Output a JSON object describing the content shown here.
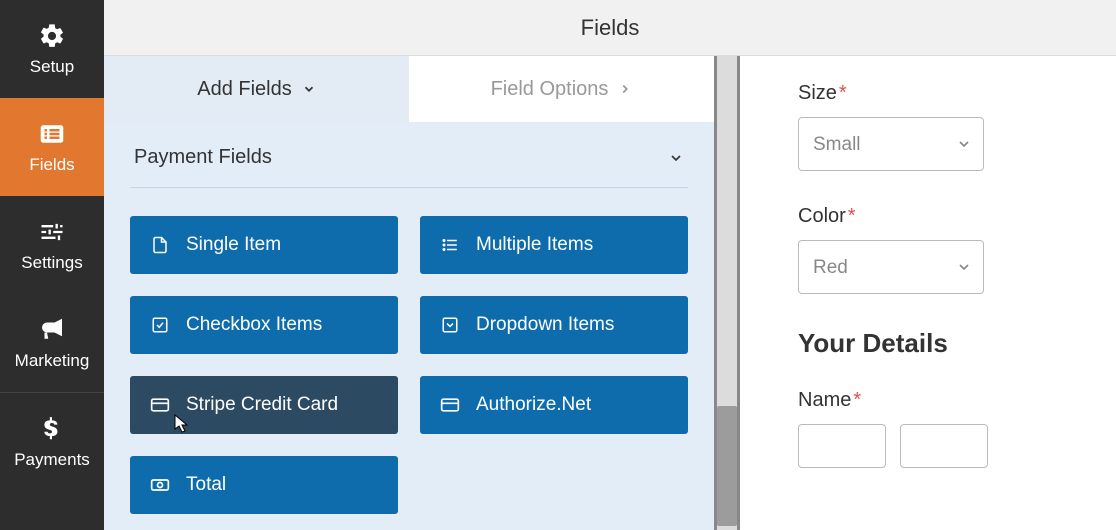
{
  "colors": {
    "accent": "#e27730",
    "primary_btn": "#0e6cad",
    "dark": "#2d2d2d"
  },
  "header": {
    "title": "Fields"
  },
  "sidebar": {
    "items": [
      {
        "id": "setup",
        "label": "Setup",
        "icon": "gear-icon"
      },
      {
        "id": "fields",
        "label": "Fields",
        "icon": "list-icon",
        "active": true
      },
      {
        "id": "settings",
        "label": "Settings",
        "icon": "sliders-icon"
      },
      {
        "id": "marketing",
        "label": "Marketing",
        "icon": "bullhorn-icon"
      },
      {
        "id": "payments",
        "label": "Payments",
        "icon": "dollar-icon"
      }
    ]
  },
  "tabs": {
    "add_fields": {
      "label": "Add Fields"
    },
    "field_options": {
      "label": "Field Options"
    }
  },
  "fields_panel": {
    "section_title": "Payment Fields",
    "items": [
      {
        "id": "single-item",
        "label": "Single Item",
        "icon": "file-icon"
      },
      {
        "id": "multiple-items",
        "label": "Multiple Items",
        "icon": "list-ul-icon"
      },
      {
        "id": "checkbox-items",
        "label": "Checkbox Items",
        "icon": "check-square-icon"
      },
      {
        "id": "dropdown-items",
        "label": "Dropdown Items",
        "icon": "caret-square-icon"
      },
      {
        "id": "stripe-cc",
        "label": "Stripe Credit Card",
        "icon": "credit-card-icon",
        "hover": true
      },
      {
        "id": "authorize-net",
        "label": "Authorize.Net",
        "icon": "credit-card-icon"
      },
      {
        "id": "total",
        "label": "Total",
        "icon": "money-icon"
      }
    ]
  },
  "preview": {
    "size": {
      "label": "Size",
      "required": true,
      "value": "Small"
    },
    "color": {
      "label": "Color",
      "required": true,
      "value": "Red"
    },
    "details_heading": "Your Details",
    "name": {
      "label": "Name",
      "required": true
    }
  }
}
